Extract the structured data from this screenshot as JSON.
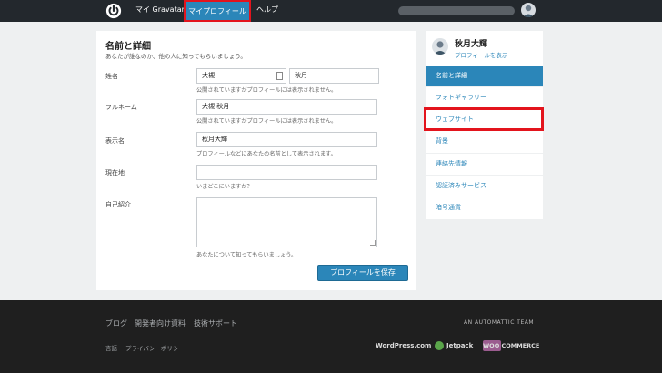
{
  "topbar": {
    "gravatar_label": "マイ Gravatar",
    "profile_label": "マイプロフィール",
    "help_label": "ヘルプ",
    "email_masked": "",
    "highlight_color": "#e3141d"
  },
  "card": {
    "title": "名前と詳細",
    "subtitle": "あなたが誰なのか、他の人に知ってもらいましょう。",
    "fields": {
      "name_label": "姓名",
      "last_name": "大槻",
      "first_name": "秋月",
      "name_hint": "公開されていますがプロフィールには表示されません。",
      "fullname_label": "フルネーム",
      "fullname_value": "大槻 秋月",
      "fullname_hint": "公開されていますがプロフィールには表示されません。",
      "display_label": "表示名",
      "display_value": "秋月大輝",
      "display_hint": "プロフィールなどにあなたの名前として表示されます。",
      "location_label": "現在地",
      "location_value": "",
      "location_hint": "いまどこにいますか？",
      "bio_label": "自己紹介",
      "bio_value": "",
      "bio_hint": "あなたについて知ってもらいましょう。"
    },
    "save_label": "プロフィールを保存"
  },
  "sidebar": {
    "user_name": "秋月大輝",
    "view_profile": "プロフィールを表示",
    "items": [
      {
        "label": "名前と詳細",
        "active": true
      },
      {
        "label": "フォトギャラリー",
        "active": false
      },
      {
        "label": "ウェブサイト",
        "active": false
      },
      {
        "label": "背景",
        "active": false
      },
      {
        "label": "連絡先情報",
        "active": false
      },
      {
        "label": "認証済みサービス",
        "active": false
      },
      {
        "label": "暗号通貨",
        "active": false
      }
    ]
  },
  "footer": {
    "links": [
      "ブログ",
      "開発者向け資料",
      "技術サポート"
    ],
    "lang": "言語",
    "privacy": "プライバシーポリシー",
    "automattic": "AN AUTOMATTIC TEAM",
    "brands": [
      "WordPress.com",
      "Jetpack",
      "WOO COMMERCE"
    ]
  },
  "colors": {
    "accent": "#2b86b9",
    "topbar": "#23282d",
    "footer": "#1f1f1f",
    "highlight": "#e3141d"
  }
}
